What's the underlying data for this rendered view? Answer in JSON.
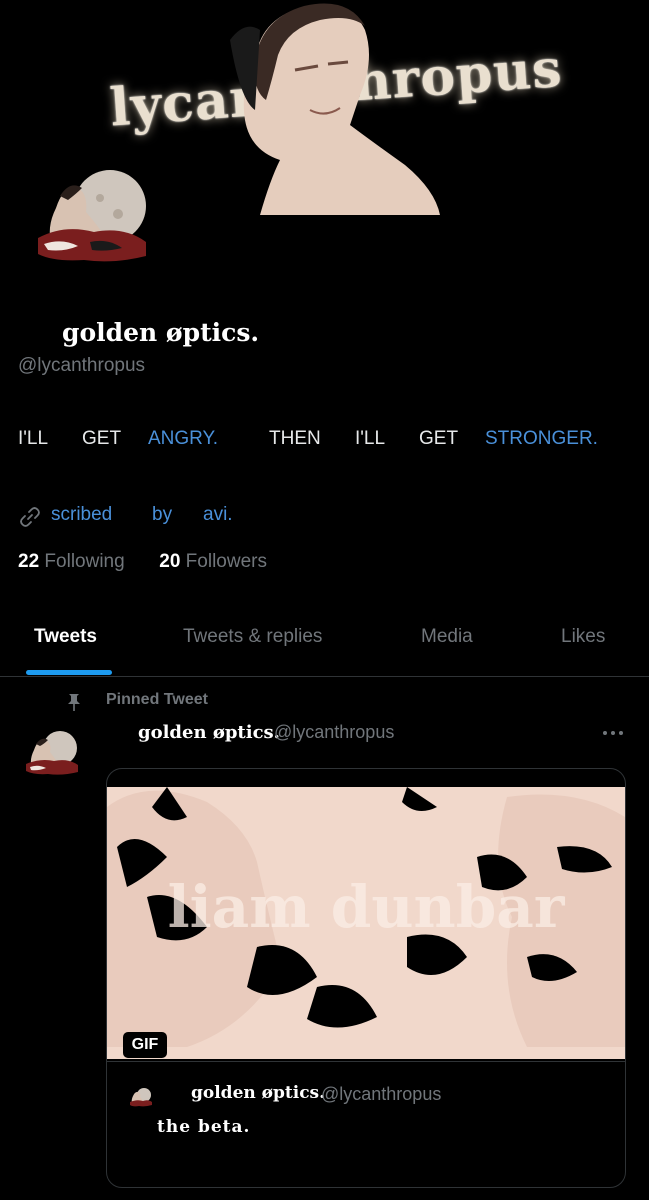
{
  "banner": {
    "text_left": "lycan",
    "text_right": "thropus"
  },
  "profile": {
    "display_name": "golden øptics.",
    "handle": "@lycanthropus",
    "bio_words": [
      "I'LL",
      "GET",
      "ANGRY.",
      "THEN",
      "I'LL",
      "GET",
      "STRONGER."
    ],
    "link_words": [
      "scribed",
      "by",
      "avi."
    ],
    "following_count": "22",
    "following_label": "Following",
    "followers_count": "20",
    "followers_label": "Followers"
  },
  "tabs": [
    {
      "label": "Tweets",
      "active": true
    },
    {
      "label": "Tweets & replies",
      "active": false
    },
    {
      "label": "Media",
      "active": false
    },
    {
      "label": "Likes",
      "active": false
    }
  ],
  "pinned_tweet": {
    "pinned_label": "Pinned Tweet",
    "author_name": "golden øptics.",
    "author_handle": "@lycanthropus",
    "media": {
      "overlay_text": "liam dunbar",
      "badge": "GIF"
    },
    "quoted": {
      "author_name": "golden øptics.",
      "author_handle": "@lycanthropus",
      "text": "the beta."
    }
  },
  "colors": {
    "background": "#000000",
    "accent": "#1d9bf0",
    "link": "#4a90d9",
    "muted": "#71767b",
    "divider": "#2f3336"
  },
  "icons": [
    "link-icon",
    "pin-icon",
    "more-icon"
  ]
}
